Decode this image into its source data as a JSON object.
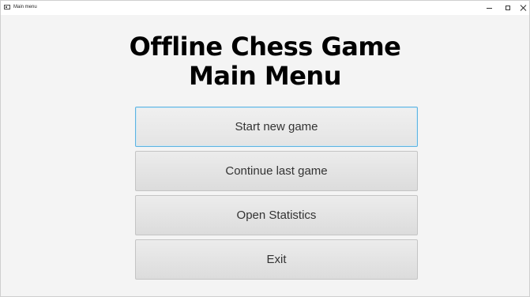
{
  "window": {
    "title": "Main menu",
    "icon": "app-window-icon",
    "controls": {
      "minimize": "minimize-icon",
      "maximize": "maximize-icon",
      "close": "close-icon"
    }
  },
  "main": {
    "heading_line1": "Offline Chess Game",
    "heading_line2": "Main Menu",
    "buttons": [
      {
        "label": "Start new game",
        "focused": true
      },
      {
        "label": "Continue last game",
        "focused": false
      },
      {
        "label": "Open Statistics",
        "focused": false
      },
      {
        "label": "Exit",
        "focused": false
      }
    ]
  },
  "colors": {
    "focus_border": "#5fb3e0",
    "button_background": "#e4e4e4",
    "window_background": "#f4f4f4"
  }
}
